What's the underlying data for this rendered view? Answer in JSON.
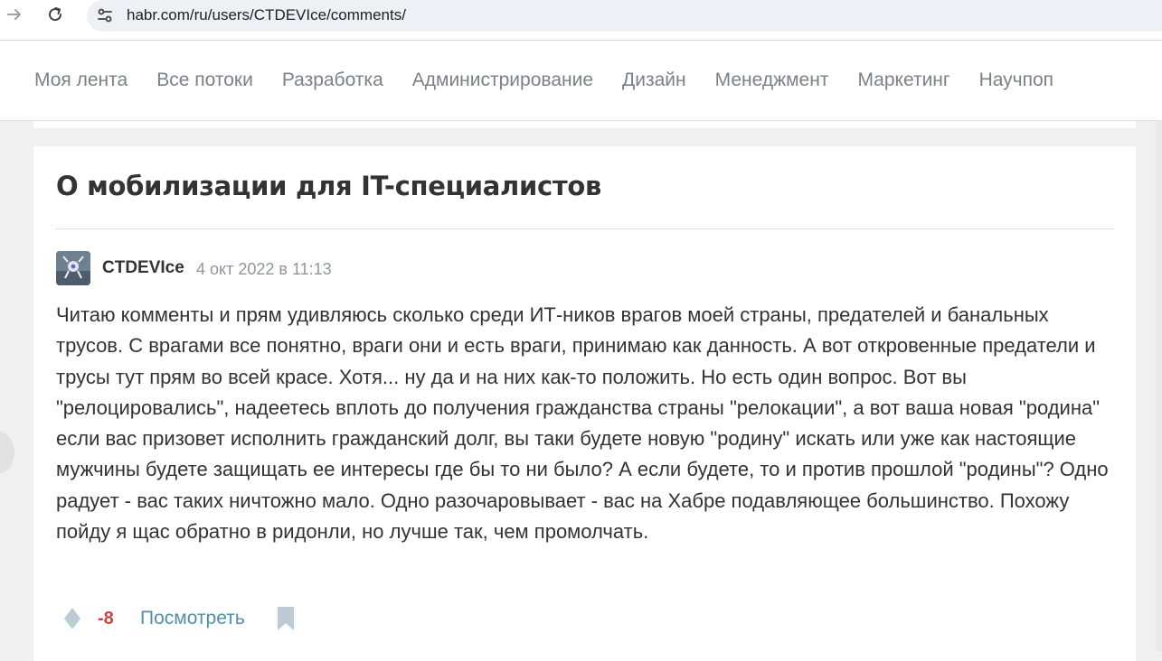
{
  "browser": {
    "url": "habr.com/ru/users/CTDEVIce/comments/"
  },
  "nav": {
    "items": [
      "Моя лента",
      "Все потоки",
      "Разработка",
      "Администрирование",
      "Дизайн",
      "Менеджмент",
      "Маркетинг",
      "Научпоп"
    ]
  },
  "post": {
    "title": "О мобилизации для IT-специалистов",
    "author": "CTDEVIce",
    "date": "4 окт 2022 в 11:13",
    "text": "Читаю комменты и прям удивляюсь сколько среди ИТ-ников врагов моей страны, предателей и банальных трусов. С врагами все понятно, враги они и есть враги, принимаю как данность. А вот откровенные предатели и трусы тут прям во всей красе. Хотя... ну да и на них как-то положить. Но есть один вопрос. Вот вы \"релоцировались\", надеетесь вплоть до получения гражданства страны \"релокации\", а вот ваша новая \"родина\" если вас призовет исполнить гражданский долг, вы таки будете новую \"родину\" искать или уже как настоящие мужчины будете защищать ее интересы где бы то ни было? А если будете, то и против прошлой \"родины\"? Одно радует - вас таких ничтожно мало. Одно разочаровывает - вас на Хабре подавляющее большинство. Похожу пойду я щас обратно в ридонли, но лучше так, чем промолчать.",
    "score": "-8",
    "view_label": "Посмотреть"
  },
  "icons": {
    "back": "arrow-right-icon",
    "reload": "reload-icon",
    "site_info": "tune-icon",
    "vote": "diamond-vote-icon",
    "bookmark": "bookmark-icon"
  },
  "colors": {
    "score_negative": "#c7463d",
    "link": "#548eaa",
    "nav_text": "#7a8288"
  }
}
